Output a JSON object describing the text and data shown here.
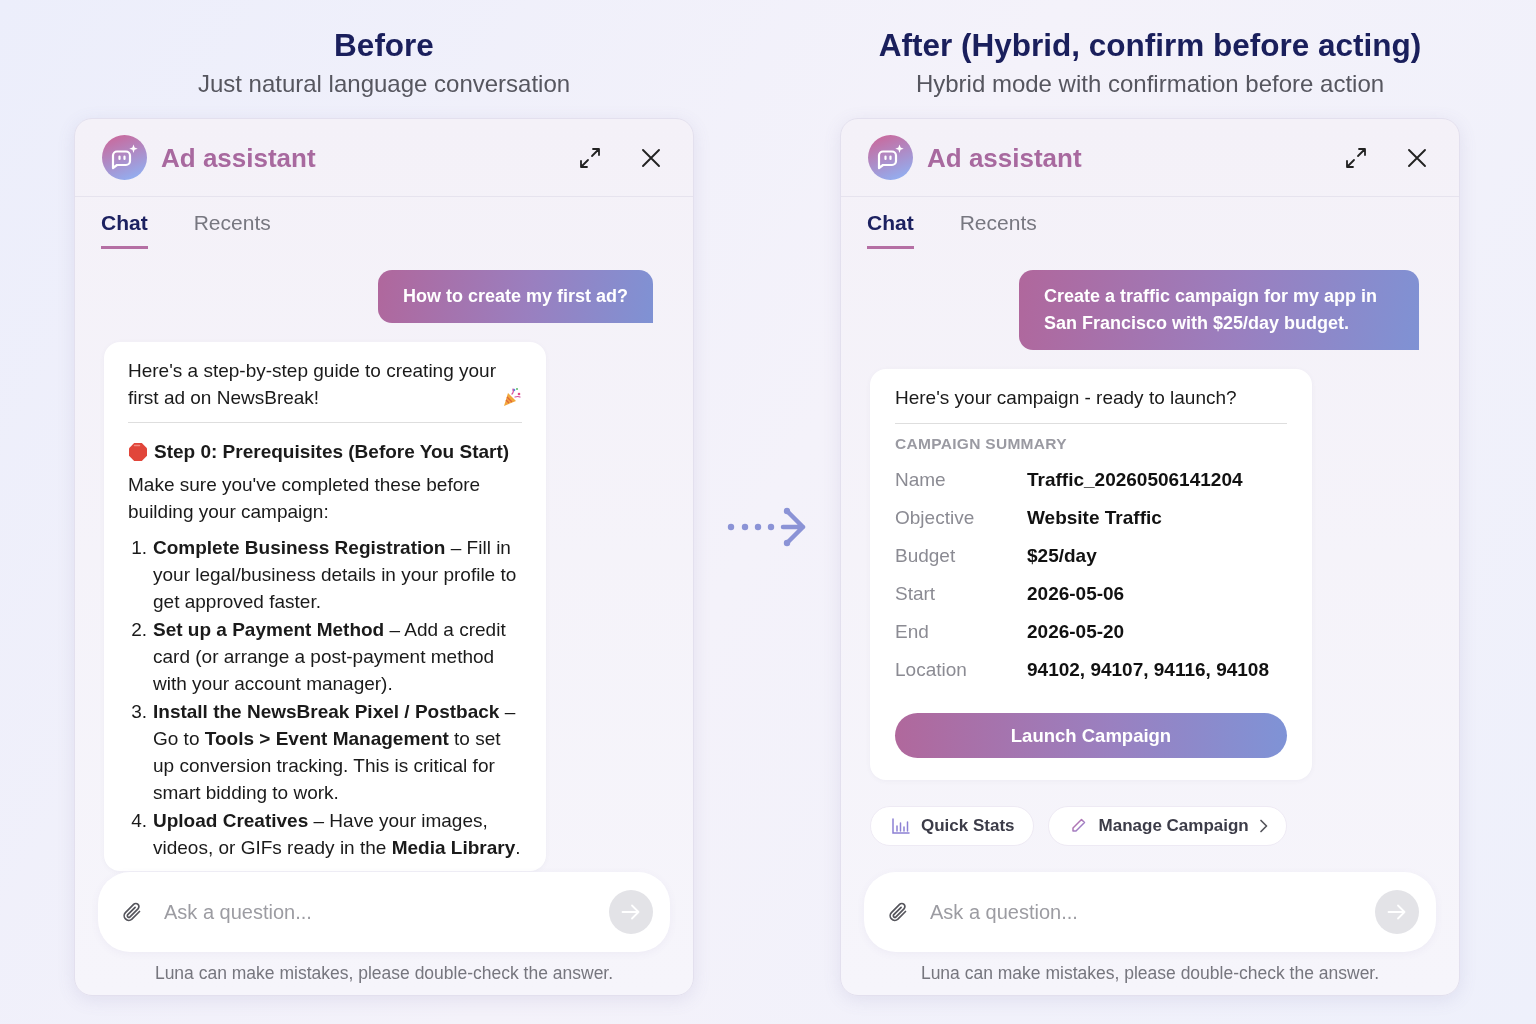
{
  "panels": [
    {
      "heading": "Before",
      "subheading": "Just natural language conversation",
      "assistant": {
        "title": "Ad assistant",
        "tabs": [
          {
            "label": "Chat",
            "selected": true
          },
          {
            "label": "Recents",
            "selected": false
          }
        ],
        "messages": [
          {
            "kind": "user",
            "text": "How to create my first ad?"
          },
          {
            "kind": "guide",
            "intro": "Here's a step-by-step guide to creating your first ad on NewsBreak!",
            "section_title": "Step 0: Prerequisites (Before You Start)",
            "lead": "Make sure you've completed these before building your campaign:",
            "steps": [
              {
                "number": "1.",
                "text": "**Complete Business Registration** – Fill in your legal/business details in your profile to get approved faster."
              },
              {
                "number": "2.",
                "text": "**Set up a Payment Method** – Add a credit card (or arrange a post-payment method with your account manager)."
              },
              {
                "number": "3.",
                "text": "**Install the NewsBreak Pixel / Postback** – Go to **Tools > Event Management** to set up conversion tracking. This is critical for smart bidding to work."
              },
              {
                "number": "4.",
                "text": "**Upload Creatives** – Have your images, videos, or GIFs ready in the **Media Library**."
              }
            ]
          }
        ],
        "input": {
          "placeholder": "Ask a question...",
          "send_disabled": true
        },
        "disclaimer": "Luna can make mistakes, please double-check the answer."
      }
    },
    {
      "heading": "After (Hybrid, confirm before acting)",
      "subheading": "Hybrid mode with confirmation before action",
      "assistant": {
        "title": "Ad assistant",
        "tabs": [
          {
            "label": "Chat",
            "selected": true
          },
          {
            "label": "Recents",
            "selected": false
          }
        ],
        "messages": [
          {
            "kind": "user",
            "text": "Create a traffic campaign for my app in San Francisco with $25/day budget."
          },
          {
            "kind": "summary",
            "intro": "Here's your campaign - ready to launch?",
            "section_title": "CAMPAIGN SUMMARY",
            "fields": [
              {
                "label": "Name",
                "value": "Traffic_20260506141204"
              },
              {
                "label": "Objective",
                "value": "Website Traffic"
              },
              {
                "label": "Budget",
                "value": "$25/day"
              },
              {
                "label": "Start",
                "value": "2026-05-06"
              },
              {
                "label": "End",
                "value": "2026-05-20"
              },
              {
                "label": "Location",
                "value": "94102, 94107, 94116, 94108"
              }
            ],
            "action": "Launch Campaign"
          },
          {
            "kind": "quick_actions",
            "items": [
              {
                "kind": "stats",
                "label": "Quick Stats",
                "chevron": false
              },
              {
                "kind": "edit",
                "label": "Manage Campaign",
                "chevron": true
              }
            ]
          }
        ],
        "input": {
          "placeholder": "Ask a question...",
          "send_disabled": true
        },
        "disclaimer": "Luna can make mistakes, please double-check the answer."
      }
    }
  ]
}
